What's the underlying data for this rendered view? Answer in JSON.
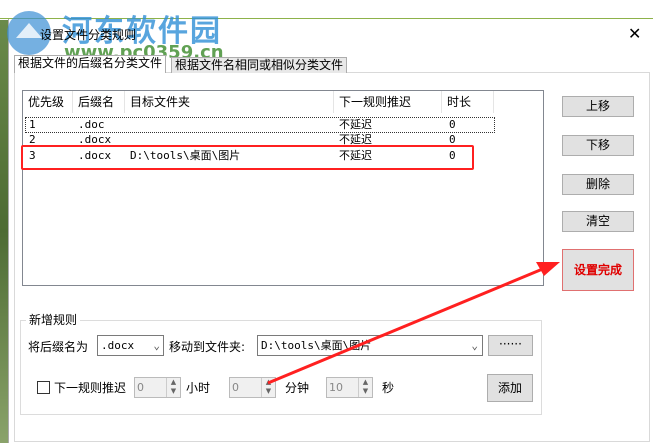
{
  "watermark": {
    "name": "河东软件园",
    "url": "www.pc0359.cn"
  },
  "window": {
    "title": "设置文件分类规则",
    "close": "✕"
  },
  "tabs": [
    {
      "label": "根据文件的后缀名分类文件",
      "active": true
    },
    {
      "label": "根据文件名相同或相似分类文件",
      "active": false
    }
  ],
  "list": {
    "headers": [
      "优先级",
      "后缀名",
      "目标文件夹",
      "下一规则推迟",
      "时长"
    ],
    "rows": [
      [
        "1",
        ".doc",
        "",
        "不延迟",
        "0"
      ],
      [
        "2",
        ".docx",
        "",
        "不延迟",
        "0"
      ],
      [
        "3",
        ".docx",
        "D:\\tools\\桌面\\图片",
        "不延迟",
        "0"
      ]
    ]
  },
  "buttons": {
    "up": "上移",
    "down": "下移",
    "delete": "删除",
    "clear": "清空",
    "finish": "设置完成",
    "browse": "······",
    "add": "添加"
  },
  "group": {
    "title": "新增规则",
    "ext_label": "将后缀名为",
    "ext_value": ".docx",
    "move_label": "移动到文件夹:",
    "folder_value": "D:\\tools\\桌面\\图片",
    "delay_label": "下一规则推迟",
    "hours": "0",
    "hours_label": "小时",
    "minutes": "0",
    "minutes_label": "分钟",
    "seconds": "10",
    "seconds_label": "秒"
  },
  "colors": {
    "highlight": "#ff2020"
  }
}
